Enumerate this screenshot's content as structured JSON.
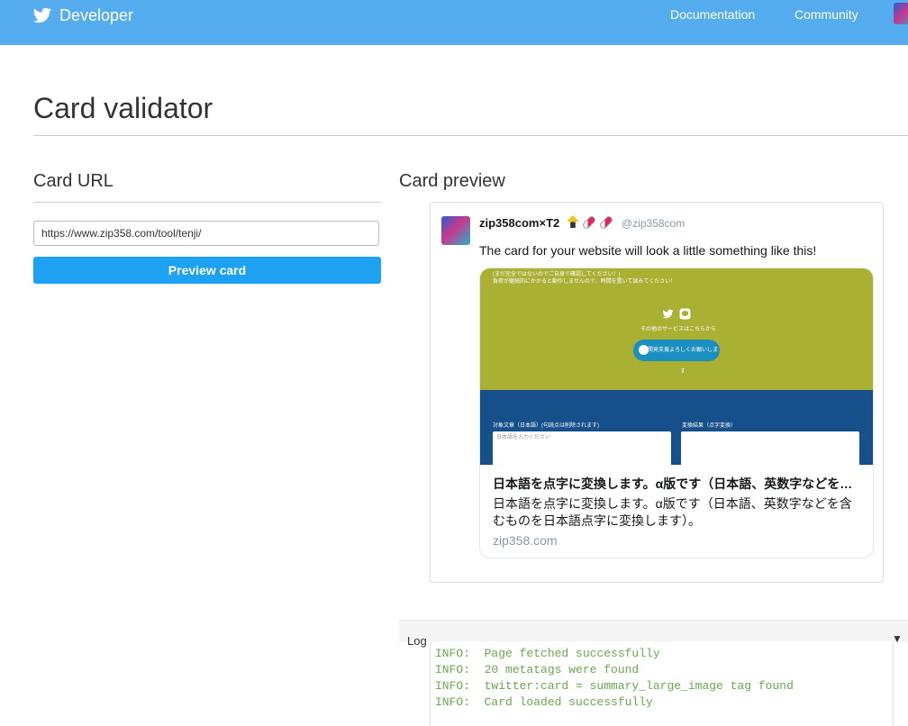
{
  "header": {
    "brand": "Developer",
    "nav": [
      "Documentation",
      "Community"
    ]
  },
  "page_title": "Card validator",
  "card_url": {
    "heading": "Card URL",
    "value": "https://www.zip358.com/tool/tenji/",
    "button": "Preview card"
  },
  "card_preview": {
    "heading": "Card preview",
    "tweet": {
      "name": "zip358com×T2",
      "handle": "@zip358com",
      "text": "The card for your website will look a little something like this!"
    },
    "card": {
      "image_text": {
        "line1": "(まだ完全ではないのでご自身で確認してください！)",
        "line2": "負荷が継続的にかかると動作しませんので、時間を置いて試みてください！",
        "other_services": "その他のサービスはこちらから",
        "pill_text": "開発支援よろしくお願いします",
        "label_left": "対象文章（日本語）(句読点は削除されます)",
        "label_right": "変換結果（点字変換）",
        "input_placeholder": "日本語を入力ください"
      },
      "title": "日本語を点字に変換します。α版です（日本語、英数字などを含むものを日本語点字に変換します）。",
      "description": "日本語を点字に変換します。α版です（日本語、英数字などを含むものを日本語点字に変換します）。",
      "domain": "zip358.com"
    }
  },
  "log": {
    "title": "Log",
    "lines": [
      "INFO:  Page fetched successfully",
      "INFO:  20 metatags were found",
      "INFO:  twitter:card = summary_large_image tag found",
      "INFO:  Card loaded successfully"
    ]
  },
  "colors": {
    "header_bg": "#55acee",
    "button_bg": "#1da1f2",
    "log_text": "#6aa84f",
    "card_olive": "#aab032",
    "card_blue": "#15508a"
  },
  "icons": [
    "twitter-bird-icon",
    "chevron-down-icon"
  ]
}
